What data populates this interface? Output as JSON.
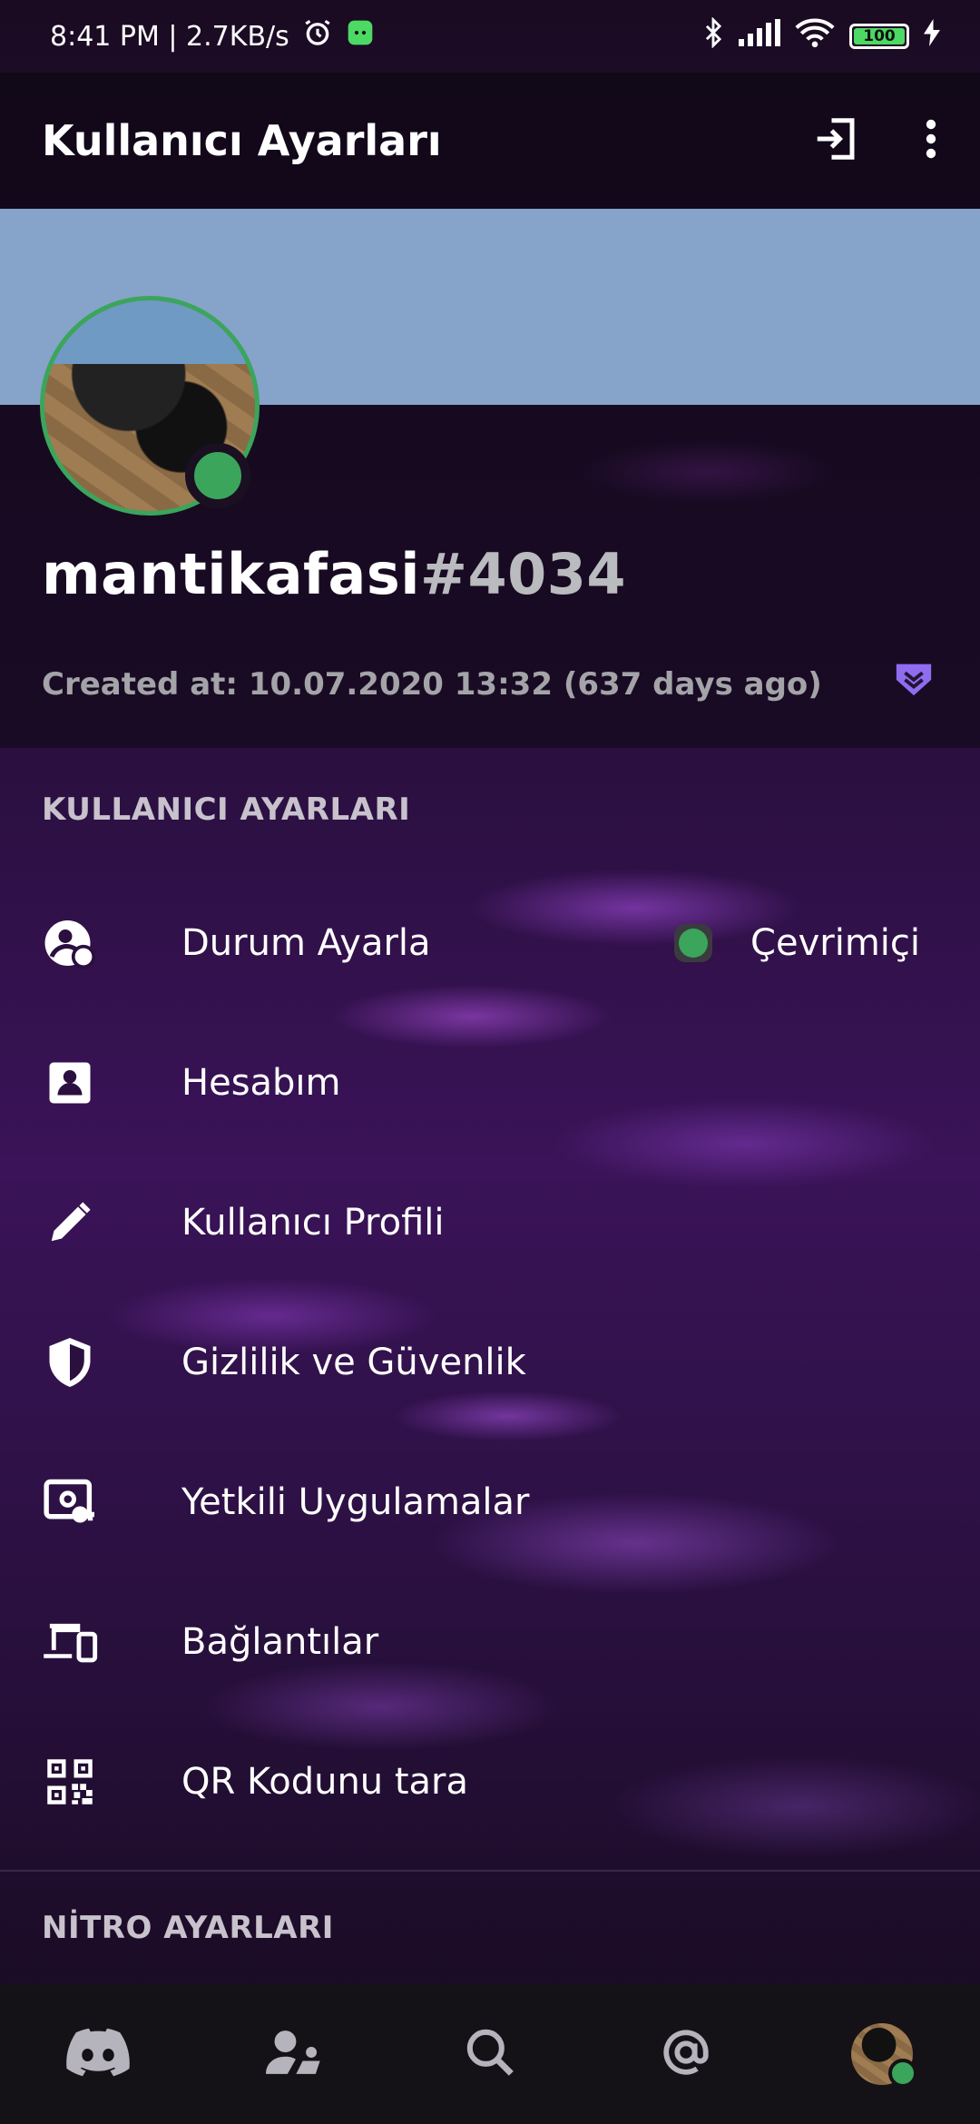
{
  "status_bar": {
    "time_speed": "8:41 PM | 2.7KB/s",
    "battery": "100"
  },
  "app_bar": {
    "title": "Kullanıcı Ayarları"
  },
  "profile": {
    "username": "mantikafasi",
    "discriminator": "#4034",
    "created_at": "Created at: 10.07.2020 13:32 (637 days ago)"
  },
  "sections": {
    "user_settings_title": "KULLANICI AYARLARI",
    "nitro_settings_title": "NİTRO AYARLARI"
  },
  "menu": [
    {
      "label": "Durum Ayarla",
      "icon": "status-icon",
      "value": "Çevrimiçi"
    },
    {
      "label": "Hesabım",
      "icon": "account-icon"
    },
    {
      "label": "Kullanıcı Profili",
      "icon": "pencil-icon"
    },
    {
      "label": "Gizlilik ve Güvenlik",
      "icon": "shield-icon"
    },
    {
      "label": "Yetkili Uygulamalar",
      "icon": "authorized-apps-icon"
    },
    {
      "label": "Bağlantılar",
      "icon": "devices-icon"
    },
    {
      "label": "QR Kodunu tara",
      "icon": "qr-code-icon"
    }
  ],
  "bottom_nav": [
    "discord-home-icon",
    "friends-icon",
    "search-icon",
    "mentions-icon",
    "profile-avatar"
  ],
  "colors": {
    "online": "#3ba55c",
    "banner": "#86a3c9",
    "badge": "#8f6cf0"
  }
}
